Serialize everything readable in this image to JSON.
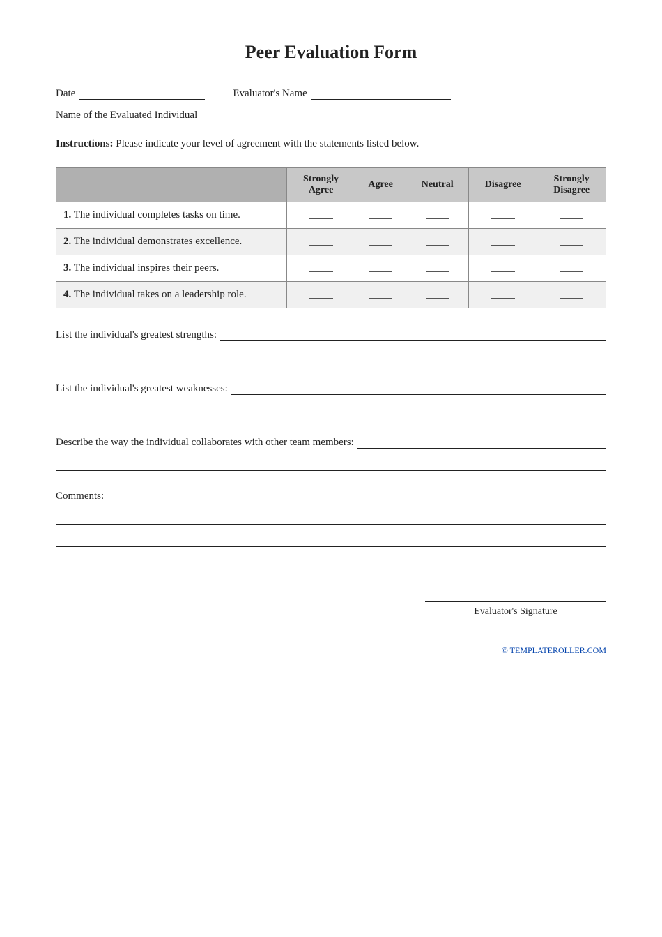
{
  "title": "Peer Evaluation Form",
  "header": {
    "date_label": "Date",
    "evaluator_name_label": "Evaluator's Name",
    "evaluated_individual_label": "Name of the Evaluated Individual"
  },
  "instructions": {
    "prefix": "Instructions:",
    "text": " Please indicate your level of agreement with the statements listed below."
  },
  "table": {
    "columns": [
      "Strongly\nAgree",
      "Agree",
      "Neutral",
      "Disagree",
      "Strongly\nDisagree"
    ],
    "rows": [
      {
        "number": "1.",
        "statement": "The individual completes tasks on time."
      },
      {
        "number": "2.",
        "statement": "The individual demonstrates excellence."
      },
      {
        "number": "3.",
        "statement": "The individual inspires their peers."
      },
      {
        "number": "4.",
        "statement": "The individual takes on a leadership role."
      }
    ]
  },
  "open_sections": [
    {
      "id": "strengths",
      "label": "List the individual's greatest strengths:"
    },
    {
      "id": "weaknesses",
      "label": "List the individual's greatest weaknesses:"
    },
    {
      "id": "collaboration",
      "label": "Describe the way the individual collaborates with other team members:"
    },
    {
      "id": "comments",
      "label": "Comments:"
    }
  ],
  "signature": {
    "label": "Evaluator's Signature"
  },
  "footer": {
    "copyright": "© TEMPLATEROLLER.COM"
  }
}
